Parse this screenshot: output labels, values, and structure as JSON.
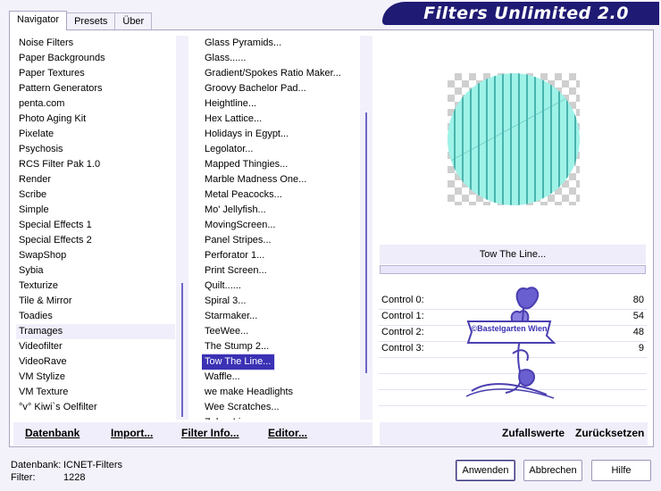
{
  "tabs": [
    "Navigator",
    "Presets",
    "Über"
  ],
  "title": "Filters Unlimited 2.0",
  "categories": [
    "Noise Filters",
    "Paper Backgrounds",
    "Paper Textures",
    "Pattern Generators",
    "penta.com",
    "Photo Aging Kit",
    "Pixelate",
    "Psychosis",
    "RCS Filter Pak 1.0",
    "Render",
    "Scribe",
    "Simple",
    "Special Effects 1",
    "Special Effects 2",
    "SwapShop",
    "Sybia",
    "Texturize",
    "Tile & Mirror",
    "Toadies",
    "Tramages",
    "Videofilter",
    "VideoRave",
    "VM Stylize",
    "VM Texture",
    "°v° Kiwi`s Oelfilter"
  ],
  "selected_category_index": 19,
  "filters": [
    "Glass Pyramids...",
    "Glass......",
    "Gradient/Spokes Ratio Maker...",
    "Groovy Bachelor Pad...",
    "Heightline...",
    "Hex Lattice...",
    "Holidays in Egypt...",
    "Legolator...",
    "Mapped Thingies...",
    "Marble Madness One...",
    "Metal Peacocks...",
    "Mo' Jellyfish...",
    "MovingScreen...",
    "Panel Stripes...",
    "Perforator 1...",
    "Print Screen...",
    "Quilt......",
    "Spiral 3...",
    "Starmaker...",
    "TeeWee...",
    "The Stump 2...",
    "Tow The Line...",
    "Waffle...",
    "we make Headlights",
    "Wee Scratches...",
    "Zebra Lines..."
  ],
  "selected_filter_index": 21,
  "left_buttons": {
    "database": "Datenbank",
    "import": "Import...",
    "filter_info": "Filter Info...",
    "editor": "Editor..."
  },
  "current_filter": "Tow The Line...",
  "controls": [
    {
      "label": "Control 0:",
      "value": "80"
    },
    {
      "label": "Control 1:",
      "value": "54"
    },
    {
      "label": "Control 2:",
      "value": "48"
    },
    {
      "label": "Control 3:",
      "value": "9"
    }
  ],
  "watermark_text": "©Bastelgarten Wien",
  "right_buttons": {
    "random": "Zufallswerte",
    "reset": "Zurücksetzen"
  },
  "status": {
    "db_label": "Datenbank:",
    "db_value": "ICNET-Filters",
    "filter_label": "Filter:",
    "filter_value": "1228"
  },
  "dialog_buttons": {
    "apply": "Anwenden",
    "cancel": "Abbrechen",
    "help": "Hilfe"
  },
  "colors": {
    "accent": "#3a31b4",
    "banner": "#1f1a73",
    "preview_cyan": "#9ff2e8",
    "watermark": "#4a3fb0"
  }
}
